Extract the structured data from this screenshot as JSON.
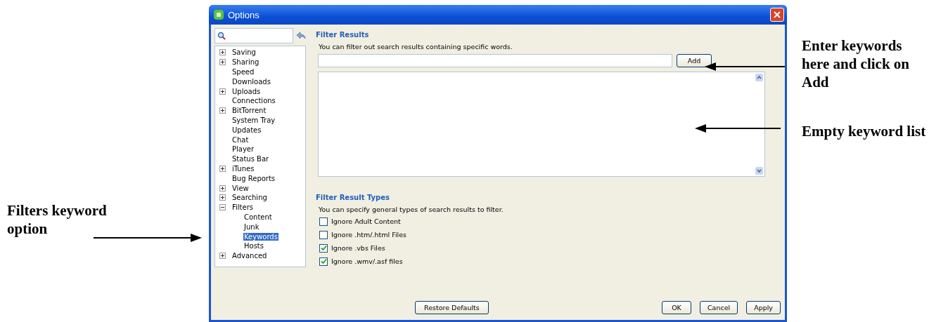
{
  "annotations": [
    {
      "text": "Filters keyword option"
    },
    {
      "text": "Enter keywords here and click on Add"
    },
    {
      "text": "Empty keyword list"
    }
  ],
  "window": {
    "title": "Options"
  },
  "sidebar": {
    "tree": [
      {
        "label": "Saving",
        "expanded": false,
        "selected": false
      },
      {
        "label": "Sharing",
        "expanded": false,
        "selected": false
      },
      {
        "label": "Speed",
        "selected": false
      },
      {
        "label": "Downloads",
        "selected": false
      },
      {
        "label": "Uploads",
        "expanded": false,
        "selected": false
      },
      {
        "label": "Connections",
        "selected": false
      },
      {
        "label": "BitTorrent",
        "expanded": false,
        "selected": false
      },
      {
        "label": "System Tray",
        "selected": false
      },
      {
        "label": "Updates",
        "selected": false
      },
      {
        "label": "Chat",
        "selected": false
      },
      {
        "label": "Player",
        "selected": false
      },
      {
        "label": "Status Bar",
        "selected": false
      },
      {
        "label": "iTunes",
        "expanded": false,
        "selected": false
      },
      {
        "label": "Bug Reports",
        "selected": false
      },
      {
        "label": "View",
        "expanded": false,
        "selected": false
      },
      {
        "label": "Searching",
        "expanded": false,
        "selected": false
      },
      {
        "label": "Filters",
        "expanded": true,
        "selected": false,
        "children": [
          {
            "label": "Content",
            "selected": false
          },
          {
            "label": "Junk",
            "selected": false
          },
          {
            "label": "Keywords",
            "selected": true
          },
          {
            "label": "Hosts",
            "selected": false
          }
        ]
      },
      {
        "label": "Advanced",
        "expanded": false,
        "selected": false
      }
    ]
  },
  "filter_results": {
    "heading": "Filter Results",
    "description": "You can filter out search results containing specific words.",
    "add_button": "Add"
  },
  "filter_result_types": {
    "heading": "Filter Result Types",
    "description": "You can specify general types of search results to filter.",
    "options": [
      {
        "label": "Ignore Adult Content",
        "checked": false
      },
      {
        "label": "Ignore .htm/.html Files",
        "checked": false
      },
      {
        "label": "Ignore .vbs Files",
        "checked": true
      },
      {
        "label": "Ignore .wmv/.asf files",
        "checked": true
      }
    ]
  },
  "footer": {
    "restore_button": "Restore Defaults",
    "buttons": [
      "OK",
      "Cancel",
      "Apply"
    ]
  }
}
